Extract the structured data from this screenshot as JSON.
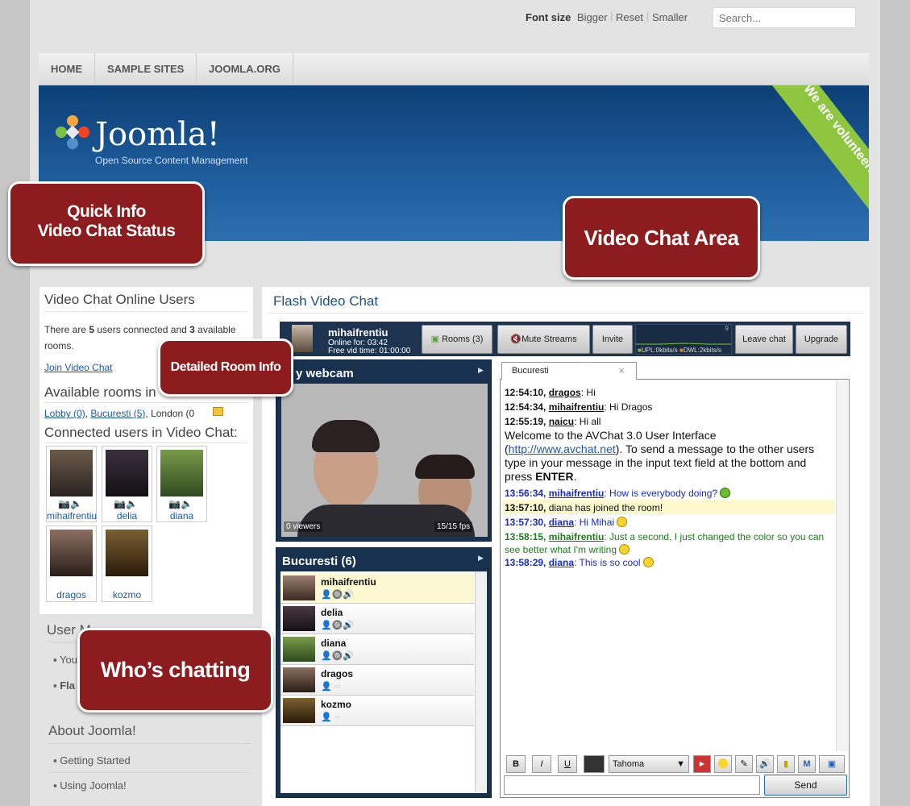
{
  "topbar": {
    "font_size_label": "Font size",
    "bigger": "Bigger",
    "reset": "Reset",
    "smaller": "Smaller",
    "search_placeholder": "Search..."
  },
  "nav": {
    "items": [
      "HOME",
      "SAMPLE SITES",
      "JOOMLA.ORG"
    ]
  },
  "banner": {
    "logo": "Joomla!",
    "tagline": "Open Source Content Management",
    "ribbon": "We are volunteers !"
  },
  "left_module": {
    "title": "Video Chat Online Users",
    "status_pre": "There are ",
    "users_count": "5",
    "status_mid": " users connected and ",
    "rooms_count": "3",
    "status_post": " available rooms.",
    "join_link": "Join Video Chat",
    "rooms_title": "Available rooms in",
    "rooms": [
      {
        "label": "Lobby (0)"
      },
      {
        "label": "Bucuresti (5)"
      },
      {
        "label": "London (0"
      }
    ],
    "connected_title": "Connected users in Video Chat:",
    "users": [
      {
        "name": "mihaifrentiu"
      },
      {
        "name": "delia"
      },
      {
        "name": "diana"
      },
      {
        "name": "dragos"
      },
      {
        "name": "kozmo"
      }
    ]
  },
  "below_left": {
    "user_menu_title": "User M",
    "user_menu_items": [
      "You",
      "Fla"
    ],
    "about_title": "About Joomla!",
    "about_items": [
      "Getting Started",
      "Using Joomla!"
    ]
  },
  "flash": {
    "title": "Flash Video Chat",
    "toolbar": {
      "username": "mihaifrentiu",
      "online_for": "Online for: 03:42",
      "free_vid": "Free vid time: 01:00:00",
      "rooms_btn": "Rooms (3)",
      "mute_btn": "Mute Streams",
      "invite_btn": "Invite",
      "graph_max": "9",
      "upl": "UPL:0kbits/s",
      "dwl": "DWL:2kbits/s",
      "leave_btn": "Leave chat",
      "upgrade_btn": "Upgrade"
    },
    "webcam": {
      "title": "y webcam",
      "viewers": "0 viewers",
      "fps": "15/15 fps"
    },
    "room_panel": {
      "title": "Bucuresti (6)",
      "users": [
        "mihaifrentiu",
        "delia",
        "diana",
        "dragos",
        "kozmo"
      ]
    },
    "chat": {
      "tab": "Bucuresti",
      "tab_close": "×",
      "messages": [
        {
          "time": "12:54:10,",
          "user": "dragos",
          "text": ": Hi"
        },
        {
          "time": "12:54:34,",
          "user": "mihaifrentiu",
          "text": ": Hi Dragos"
        },
        {
          "time": "12:55:19,",
          "user": "naicu",
          "text": ": Hi all"
        }
      ],
      "welcome_pre": "Welcome to the AVChat 3.0 User Interface (",
      "welcome_link": "http://www.avchat.net",
      "welcome_mid": "). To send a message to the other users type in your message in the input text field at the bottom and press ",
      "welcome_enter": "ENTER",
      "welcome_end": ".",
      "m4": {
        "time": "13:56:34,",
        "user": "mihaifrentiu",
        "text": ": How is everybody doing?"
      },
      "m5": {
        "time": "13:57:10,",
        "text": "diana has joined the room!"
      },
      "m6": {
        "time": "13:57:30,",
        "user": "diana",
        "text": ": Hi Mihai"
      },
      "m7": {
        "time": "13:58:15,",
        "user": "mihaifrentiu",
        "text": ": Just a second, I just changed the color so you can see better what I'm writing"
      },
      "m8": {
        "time": "13:58:29,",
        "user": "diana",
        "text": ": This is so cool"
      },
      "format": {
        "bold": "B",
        "italic": "I",
        "underline": "U",
        "font": "Tahoma"
      },
      "send": "Send"
    }
  },
  "callouts": {
    "quick_info": "Quick Info\nVideo Chat Status",
    "video_area": "Video Chat Area",
    "room_info": "Detailed Room Info",
    "whos_chatting": "Who’s chatting"
  }
}
